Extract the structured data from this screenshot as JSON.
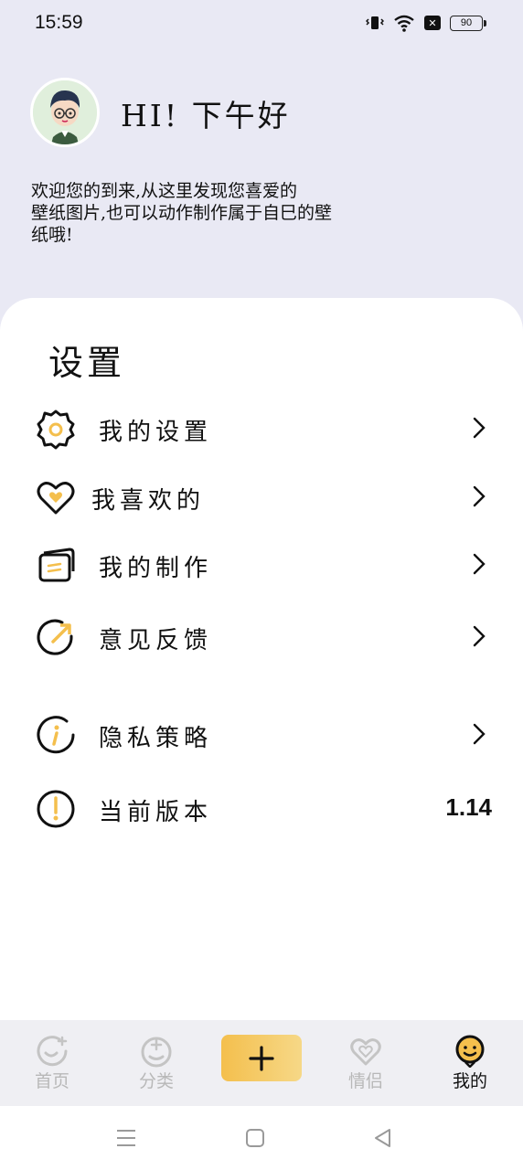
{
  "status": {
    "time": "15:59",
    "battery": "90"
  },
  "header": {
    "greeting": "HI! 下午好",
    "welcome_lines": [
      "欢迎您的到来,从这里发现您喜爱的",
      "壁纸图片,也可以动作制作属于自巳的壁",
      "纸哦!"
    ]
  },
  "settings": {
    "title": "设置",
    "items": [
      {
        "label": "我的设置",
        "icon": "gear-icon"
      },
      {
        "label": "我喜欢的",
        "icon": "heart-icon"
      },
      {
        "label": "我的制作",
        "icon": "cards-icon"
      },
      {
        "label": "意见反馈",
        "icon": "feedback-arrow-icon"
      },
      {
        "label": "隐私策略",
        "icon": "info-icon"
      },
      {
        "label": "当前版本",
        "icon": "exclamation-icon",
        "value": "1.14"
      }
    ]
  },
  "tabs": [
    {
      "label": "首页",
      "icon": "home-smile-icon"
    },
    {
      "label": "分类",
      "icon": "category-icon"
    },
    {
      "label": "情侣",
      "icon": "couple-heart-icon"
    },
    {
      "label": "我的",
      "icon": "profile-smile-icon",
      "active": true
    }
  ],
  "colors": {
    "accent": "#f4bf4d",
    "background": "#e9e9f4",
    "inactive_tab": "#b8b8b8"
  }
}
